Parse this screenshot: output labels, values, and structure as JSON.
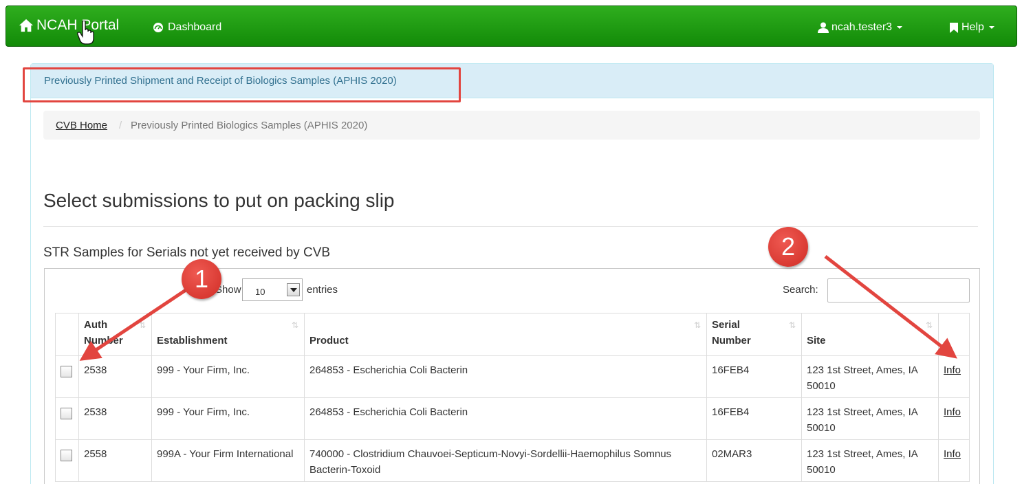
{
  "navbar": {
    "brand": "NCAH Portal",
    "dashboard": "Dashboard",
    "user": "ncah.tester3",
    "help": "Help",
    "brand_color": "#1f9c14"
  },
  "panel": {
    "title": "Previously Printed Shipment and Receipt of Biologics Samples (APHIS 2020)"
  },
  "breadcrumb": {
    "home": "CVB Home",
    "separator": "/",
    "current": "Previously Printed Biologics Samples (APHIS 2020)"
  },
  "page": {
    "heading": "Select submissions to put on packing slip",
    "section_title": "STR Samples for Serials not yet received by CVB"
  },
  "table_controls": {
    "show_label": "Show",
    "entries_value": "10",
    "entries_label": "entries",
    "search_label": "Search:"
  },
  "table": {
    "headers": {
      "auth": "Auth Number",
      "establishment": "Establishment",
      "product": "Product",
      "serial": "Serial Number",
      "site": "Site"
    },
    "rows": [
      {
        "auth": "2538",
        "establishment": "999 - Your Firm, Inc.",
        "product": "264853 - Escherichia Coli Bacterin",
        "serial": "16FEB4",
        "site": "123 1st Street, Ames, IA 50010",
        "info": "Info"
      },
      {
        "auth": "2538",
        "establishment": "999 - Your Firm, Inc.",
        "product": "264853 - Escherichia Coli Bacterin",
        "serial": "16FEB4",
        "site": "123 1st Street, Ames, IA 50010",
        "info": "Info"
      },
      {
        "auth": "2558",
        "establishment": "999A - Your Firm International",
        "product": "740000 - Clostridium Chauvoei-Septicum-Novyi-Sordellii-Haemophilus Somnus Bacterin-Toxoid",
        "serial": "02MAR3",
        "site": "123 1st Street, Ames, IA 50010",
        "info": "Info"
      }
    ]
  },
  "annotations": {
    "badge_1": "1",
    "badge_2": "2",
    "color": "#e2453f"
  }
}
